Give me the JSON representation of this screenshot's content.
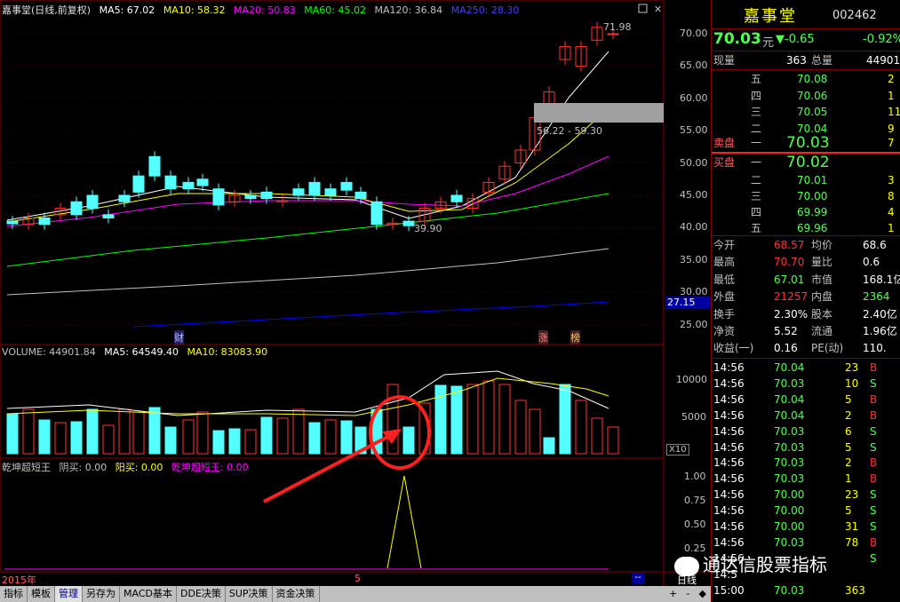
{
  "header": {
    "title": "嘉事堂(日线,前复权)",
    "ma5": "MA5: 67.02",
    "ma10": "MA10: 58.32",
    "ma20": "MA20: 50.83",
    "ma60": "MA60: 45.02",
    "ma120": "MA120: 36.84",
    "ma250": "MA250: 28.30"
  },
  "price_panel": {
    "high_label": "71.98",
    "low_label": "39.90",
    "range_label": "56.22 - 59.30",
    "current_marker": "27.15",
    "axis": [
      "70.00",
      "65.00",
      "60.00",
      "55.00",
      "50.00",
      "45.00",
      "40.00",
      "35.00",
      "30.00",
      "25.00"
    ],
    "marks": {
      "cai": "财",
      "zhang": "涨",
      "bang": "榜"
    }
  },
  "volume_panel": {
    "label": "VOLUME: 44901.84",
    "ma5": "MA5: 64549.40",
    "ma10": "MA10: 83083.90",
    "axis": [
      "10000",
      "5000"
    ],
    "unit": "X10"
  },
  "indicator_panel": {
    "name": "乾坤超短王",
    "yinmai": "阴买: 0.00",
    "yangmai": "阳买: 0.00",
    "value": "乾坤超短王: 0.00",
    "axis": [
      "1.00",
      "0.75",
      "0.50",
      "0.25"
    ]
  },
  "bottom_bar": {
    "year": "2015年",
    "month": "5",
    "period": "日线"
  },
  "tabs": [
    "指标",
    "模板",
    "管理",
    "另存为",
    "MACD基本",
    "DDE决策",
    "SUP决策",
    "资金决策"
  ],
  "active_tab": "管理",
  "side": {
    "name": "嘉事堂",
    "code": "002462",
    "price": "70.03",
    "price_unit": "元",
    "change": "-0.65",
    "change_pct": "-0.92%",
    "xianliang_label": "现量",
    "xianliang": "363",
    "zongliang_label": "总量",
    "zongliang": "44901",
    "sell": [
      {
        "level": "五",
        "price": "70.08",
        "vol": "2"
      },
      {
        "level": "四",
        "price": "70.06",
        "vol": "1"
      },
      {
        "level": "三",
        "price": "70.05",
        "vol": "11"
      },
      {
        "level": "二",
        "price": "70.04",
        "vol": "9"
      },
      {
        "level": "一",
        "price": "70.03",
        "vol": "7"
      }
    ],
    "sell_label": "卖盘",
    "buy_label": "买盘",
    "buy": [
      {
        "level": "一",
        "price": "70.02",
        "vol": ""
      },
      {
        "level": "二",
        "price": "70.01",
        "vol": "3"
      },
      {
        "level": "三",
        "price": "70.00",
        "vol": "8"
      },
      {
        "level": "四",
        "price": "69.99",
        "vol": "4"
      },
      {
        "level": "五",
        "price": "69.96",
        "vol": "1"
      }
    ],
    "stats": [
      {
        "l1": "今开",
        "v1": "68.57",
        "l2": "均价",
        "v2": "68.6"
      },
      {
        "l1": "最高",
        "v1": "70.70",
        "l2": "量比",
        "v2": "0.6"
      },
      {
        "l1": "最低",
        "v1": "67.01",
        "l2": "市值",
        "v2": "168.1亿"
      },
      {
        "l1": "外盘",
        "v1": "21257",
        "l2": "内盘",
        "v2": "2364"
      },
      {
        "l1": "换手",
        "v1": "2.30%",
        "l2": "股本",
        "v2": "2.40亿"
      },
      {
        "l1": "净资",
        "v1": "5.52",
        "l2": "流通",
        "v2": "1.96亿"
      },
      {
        "l1": "收益(一)",
        "v1": "0.16",
        "l2": "PE(动)",
        "v2": "110."
      }
    ],
    "ticks": [
      {
        "t": "14:56",
        "p": "70.04",
        "v": "23",
        "d": "B"
      },
      {
        "t": "14:56",
        "p": "70.03",
        "v": "10",
        "d": "S"
      },
      {
        "t": "14:56",
        "p": "70.04",
        "v": "5",
        "d": "B"
      },
      {
        "t": "14:56",
        "p": "70.04",
        "v": "2",
        "d": "B"
      },
      {
        "t": "14:56",
        "p": "70.03",
        "v": "6",
        "d": "S"
      },
      {
        "t": "14:56",
        "p": "70.03",
        "v": "5",
        "d": "S"
      },
      {
        "t": "14:56",
        "p": "70.03",
        "v": "2",
        "d": "B"
      },
      {
        "t": "14:56",
        "p": "70.03",
        "v": "1",
        "d": "B"
      },
      {
        "t": "14:56",
        "p": "70.00",
        "v": "23",
        "d": "S"
      },
      {
        "t": "14:56",
        "p": "70.00",
        "v": "5",
        "d": "S"
      },
      {
        "t": "14:56",
        "p": "70.00",
        "v": "31",
        "d": "S"
      },
      {
        "t": "14:56",
        "p": "70.03",
        "v": "78",
        "d": "B"
      },
      {
        "t": "14:56",
        "p": "",
        "v": "",
        "d": "S"
      },
      {
        "t": "14:5",
        "p": "",
        "v": "",
        "d": ""
      },
      {
        "t": "15:00",
        "p": "70.03",
        "v": "363",
        "d": ""
      }
    ],
    "watermark": "通达信股票指标"
  },
  "colors": {
    "up": "#ff3232",
    "down": "#54ffff",
    "bg": "#000000",
    "border": "#800000"
  }
}
